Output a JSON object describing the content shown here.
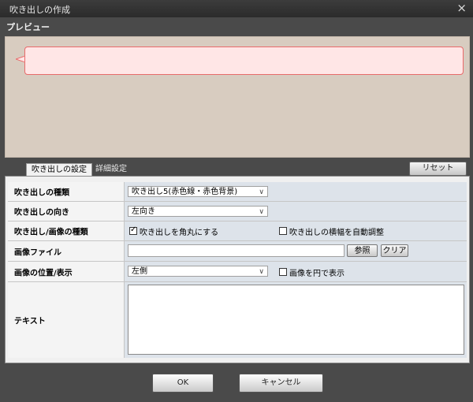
{
  "window": {
    "title": "吹き出しの作成",
    "close_glyph": "×"
  },
  "preview": {
    "label": "プレビュー",
    "bubble_fill": "#ffe6e6",
    "bubble_border": "#e86a6a"
  },
  "tabs": [
    {
      "label": "吹き出しの設定",
      "active": true
    },
    {
      "label": "詳細設定",
      "active": false
    }
  ],
  "reset_label": "リセット",
  "rows": {
    "type": {
      "label": "吹き出しの種類",
      "value": "吹き出し5(赤色線・赤色背景)"
    },
    "direction": {
      "label": "吹き出しの向き",
      "value": "左向き"
    },
    "shape": {
      "label": "吹き出し/画像の種類",
      "rounded": {
        "label": "吹き出しを角丸にする",
        "checked": true,
        "check_glyph": "✓"
      },
      "autowidth": {
        "label": "吹き出しの横幅を自動調整",
        "checked": false
      }
    },
    "image_file": {
      "label": "画像ファイル",
      "value": "",
      "browse_label": "参照",
      "clear_label": "クリア"
    },
    "image_position": {
      "label": "画像の位置/表示",
      "value": "左側",
      "circle": {
        "label": "画像を円で表示",
        "checked": false
      }
    },
    "text": {
      "label": "テキスト",
      "value": ""
    }
  },
  "buttons": {
    "ok": "OK",
    "cancel": "キャンセル"
  },
  "icons": {
    "dropdown": "chevron-down-icon",
    "close": "close-icon"
  }
}
